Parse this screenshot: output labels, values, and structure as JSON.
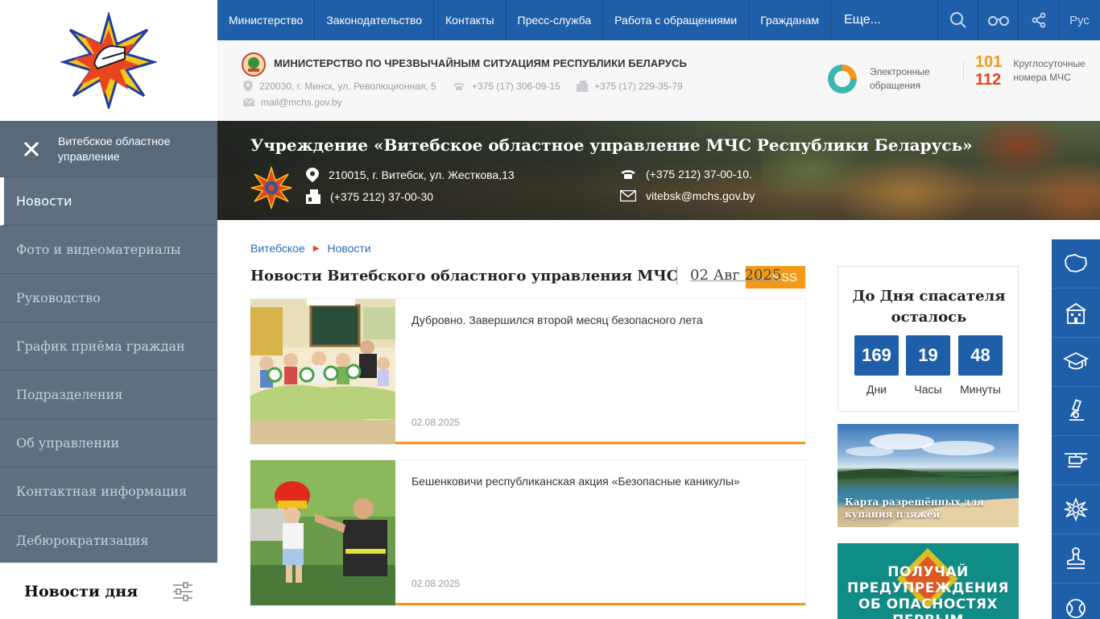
{
  "topnav": {
    "items": [
      "Министерство",
      "Законодательство",
      "Контакты",
      "Пресс-служба",
      "Работа с обращениями",
      "Гражданам"
    ],
    "more": "Еще...",
    "lang": "Рус"
  },
  "ministry": {
    "title": "МИНИСТЕРСТВО ПО ЧРЕЗВЫЧАЙНЫМ СИТУАЦИЯМ РЕСПУБЛИКИ БЕЛАРУСЬ",
    "address": "220030, г. Минск, ул. Революционная, 5",
    "phone": "+375 (17) 306-09-15",
    "fax": "+375 (17) 229-35-79",
    "email": "mail@mchs.gov.by",
    "eapp_line1": "Электронные",
    "eapp_line2": "обращения",
    "hot1": "101",
    "hot2": "112",
    "hot_line1": "Круглосуточные",
    "hot_line2": "номера МЧС"
  },
  "sidebar": {
    "head_line1": "Витебское областное",
    "head_line2": "управление",
    "items": [
      "Новости",
      "Фото и видеоматериалы",
      "Руководство",
      "График приёма граждан",
      "Подразделения",
      "Об управлении",
      "Контактная информация",
      "Дебюрократизация"
    ],
    "news_day": "Новости дня"
  },
  "banner": {
    "title": "Учреждение «Витебское областное управление МЧС Республики Беларусь»",
    "address": "210015, г. Витебск, ул. Жесткова,13",
    "fax": "(+375 212) 37-00-30",
    "phone": "(+375 212) 37-00-10.",
    "email": "vitebsk@mchs.gov.by"
  },
  "breadcrumb": {
    "root": "Витебское",
    "current": "Новости"
  },
  "news": {
    "heading": "Новости Витебского областного управления МЧС",
    "date": "02 Авг 2025",
    "rss": "RSS",
    "cards": [
      {
        "title": "Дубровно. Завершился второй месяц безопасного лета",
        "date": "02.08.2025"
      },
      {
        "title": "Бешенковичи республиканская акция «Безопасные каникулы»",
        "date": "02.08.2025"
      }
    ]
  },
  "countdown": {
    "line1": "До Дня спасателя",
    "line2": "осталось",
    "days": "169",
    "hours": "19",
    "minutes": "48",
    "days_label": "Дни",
    "hours_label": "Часы",
    "minutes_label": "Минуты"
  },
  "promo1": {
    "line1": "Карта разрешённых для",
    "line2": "купания пляжей"
  },
  "promo2": {
    "line1": "ПОЛУЧАЙ",
    "line2": "ПРЕДУПРЕЖДЕНИЯ",
    "line3": "ОБ ОПАСНОСТЯХ",
    "line4": "ПЕРВЫМ"
  },
  "colors": {
    "primary": "#1f5ea8",
    "accent": "#f29a16",
    "danger": "#e2461e",
    "sidebar": "#5e6f7f"
  },
  "rbar_icons": [
    "belarus-map-icon",
    "building-icon",
    "graduation-cap-icon",
    "microscope-icon",
    "helicopter-icon",
    "emblem-icon",
    "stamp-icon",
    "tennis-icon"
  ]
}
